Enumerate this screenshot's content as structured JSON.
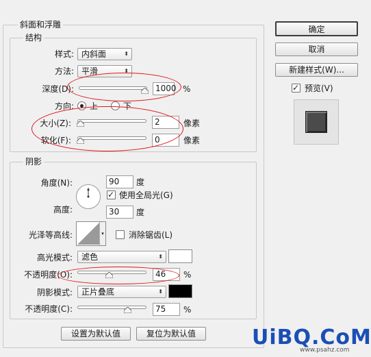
{
  "bevel": {
    "title": "斜面和浮雕",
    "structure": {
      "title": "结构",
      "style_label": "样式:",
      "style_value": "内斜面",
      "technique_label": "方法:",
      "technique_value": "平滑",
      "depth_label": "深度(D):",
      "depth_value": "1000",
      "depth_unit": "%",
      "depth_slider": 1.0,
      "direction_label": "方向:",
      "direction_up": "上",
      "direction_down": "下",
      "direction_selected": "上",
      "size_label": "大小(Z):",
      "size_value": "2",
      "size_unit": "像素",
      "size_slider": 0.0,
      "soften_label": "软化(F):",
      "soften_value": "0",
      "soften_unit": "像素",
      "soften_slider": 0.0
    },
    "shading": {
      "title": "阴影",
      "angle_label": "角度(N):",
      "angle_value": "90",
      "angle_unit": "度",
      "global_light_label": "使用全局光(G)",
      "global_light_checked": true,
      "altitude_label": "高度:",
      "altitude_value": "30",
      "altitude_unit": "度",
      "gloss_contour_label": "光泽等高线:",
      "antialias_label": "消除锯齿(L)",
      "antialias_checked": false,
      "highlight_mode_label": "高光模式:",
      "highlight_mode_value": "滤色",
      "highlight_color": "#ffffff",
      "highlight_opacity_label": "不透明度(O):",
      "highlight_opacity_value": "46",
      "highlight_opacity_unit": "%",
      "highlight_opacity_slider": 0.46,
      "shadow_mode_label": "阴影模式:",
      "shadow_mode_value": "正片叠底",
      "shadow_color": "#000000",
      "shadow_opacity_label": "不透明度(C):",
      "shadow_opacity_value": "75",
      "shadow_opacity_unit": "%",
      "shadow_opacity_slider": 0.75
    },
    "make_default_label": "设置为默认值",
    "reset_default_label": "复位为默认值"
  },
  "sidebar": {
    "ok_label": "确定",
    "cancel_label": "取消",
    "new_style_label": "新建样式(W)...",
    "preview_label": "预览(V)",
    "preview_checked": true
  },
  "watermark": {
    "brand": "UiBQ.CoM",
    "site": "www.psahz.com"
  },
  "colors": {
    "annotation": "#e2141a",
    "brand_blue": "#1a4fb5",
    "brand_green": "#2e9b3a"
  }
}
